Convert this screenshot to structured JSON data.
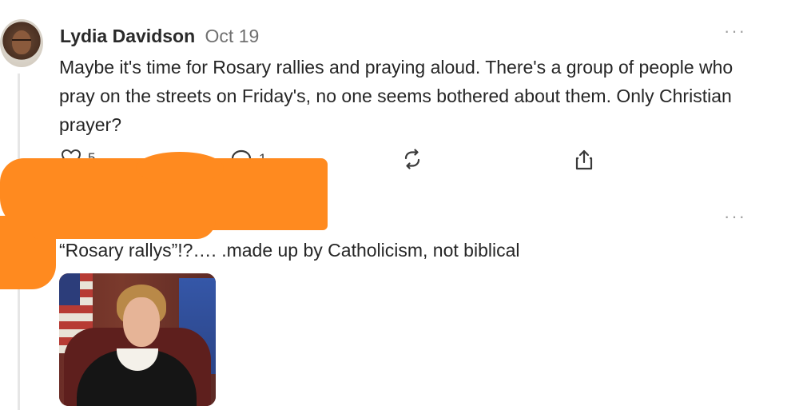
{
  "post": {
    "author": "Lydia Davidson",
    "date": "Oct 19",
    "text": "Maybe it's time for Rosary rallies and praying aloud. There's a group of people who pray on the streets on Friday's, no one seems bothered about them. Only Christian prayer?",
    "more_label": "···",
    "actions": {
      "like_count": "5",
      "reply_count": "1"
    }
  },
  "reply": {
    "text": "“Rosary rallys”!?…. .made up by Catholicism, not biblical",
    "more_label": "···"
  },
  "icons": {
    "like": "heart-icon",
    "reply": "speech-bubble-icon",
    "repost": "repost-icon",
    "share": "share-icon",
    "more": "more-dots-icon"
  },
  "colors": {
    "redaction": "#ff8a1f",
    "text": "#262626",
    "muted": "#707070",
    "thread_line": "#e6e6e6"
  }
}
